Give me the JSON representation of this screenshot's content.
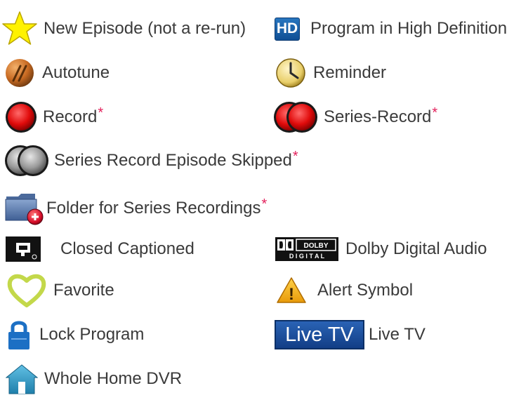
{
  "legend": [
    {
      "id": "new-episode",
      "icon": "star-icon",
      "label": "New Episode (not a re-run)",
      "asterisk": ""
    },
    {
      "id": "hd",
      "icon": "hd-icon",
      "icon_text": "HD",
      "label": "Program in High Definition",
      "asterisk": ""
    },
    {
      "id": "autotune",
      "icon": "autotune-icon",
      "label": "Autotune",
      "asterisk": ""
    },
    {
      "id": "reminder",
      "icon": "clock-icon",
      "label": "Reminder",
      "asterisk": ""
    },
    {
      "id": "record",
      "icon": "record-icon",
      "label": "Record",
      "asterisk": "*"
    },
    {
      "id": "series-record",
      "icon": "series-record-icon",
      "label": "Series-Record",
      "asterisk": "*"
    },
    {
      "id": "series-skipped",
      "icon": "series-skipped-icon",
      "label": "Series Record Episode Skipped",
      "asterisk": "*"
    },
    {
      "id": "folder",
      "icon": "folder-icon",
      "label": "Folder for Series Recordings",
      "asterisk": "*"
    },
    {
      "id": "closed-captioned",
      "icon": "closed-caption-icon",
      "label": "Closed Captioned",
      "asterisk": ""
    },
    {
      "id": "dolby",
      "icon": "dolby-icon",
      "icon_text_top": "DOLBY",
      "icon_text_bottom": "D I G I T A L",
      "label": "Dolby Digital Audio",
      "asterisk": ""
    },
    {
      "id": "favorite",
      "icon": "heart-icon",
      "label": "Favorite",
      "asterisk": ""
    },
    {
      "id": "alert",
      "icon": "alert-icon",
      "icon_text": "!",
      "label": "Alert Symbol",
      "asterisk": ""
    },
    {
      "id": "lock",
      "icon": "lock-icon",
      "label": "Lock Program",
      "asterisk": ""
    },
    {
      "id": "live-tv",
      "icon": "live-tv-icon",
      "icon_text": "Live TV",
      "label": "Live TV",
      "asterisk": ""
    },
    {
      "id": "whole-home",
      "icon": "house-icon",
      "label": "Whole Home DVR",
      "asterisk": ""
    }
  ],
  "colors": {
    "text": "#3a3a3a",
    "asterisk": "#e3215c",
    "star": "#fff200",
    "hd_blue": "#1a62ad",
    "record_red": "#e00b0b",
    "heart_green": "#c3d84a",
    "alert_yellow": "#f5b31a",
    "lock_blue": "#1c6fc4",
    "live_tv_blue": "#1b4f9f",
    "house_teal": "#2d9ac4"
  }
}
